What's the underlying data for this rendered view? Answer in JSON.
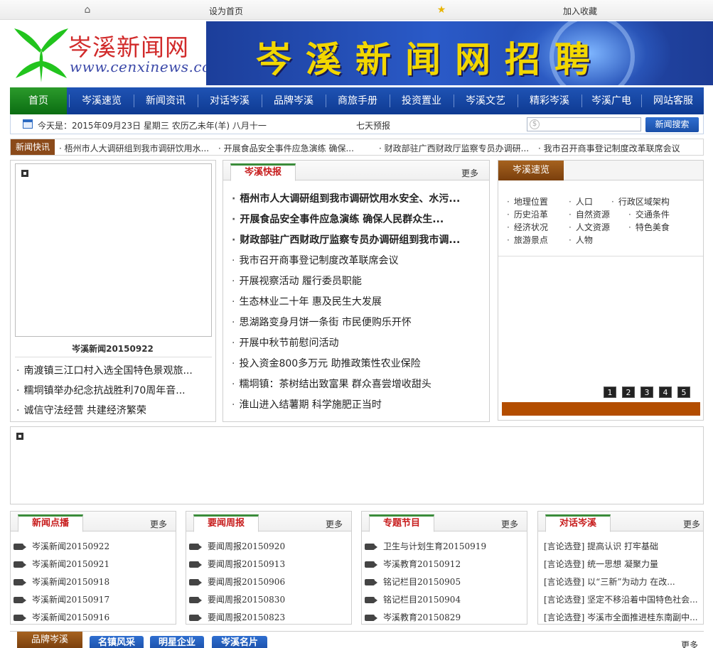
{
  "topbar": {
    "set_home": "设为首页",
    "bookmark": "加入收藏"
  },
  "logo": {
    "name": "岑溪新闻网",
    "url": "www.cenxinews.com"
  },
  "banner": {
    "text": "岑溪新闻网招聘"
  },
  "nav": {
    "items": [
      "首页",
      "岑溪速览",
      "新闻资讯",
      "对话岑溪",
      "品牌岑溪",
      "商旅手册",
      "投资置业",
      "岑溪文艺",
      "精彩岑溪",
      "岑溪广电",
      "网站客服"
    ]
  },
  "datebar": {
    "date": "今天是：2015年09月23日  星期三   农历乙未年(羊) 八月十一",
    "forecast": "七天预报",
    "search_button": "新闻搜索",
    "search_placeholder": ""
  },
  "ticker": {
    "label": "新闻快讯",
    "items": [
      "梧州市人大调研组到我市调研饮用水...",
      "开展食品安全事件应急演练 确保...",
      "财政部驻广西财政厅监察专员办调研...",
      "我市召开商事登记制度改革联席会议"
    ]
  },
  "left": {
    "caption": "岑溪新闻20150922",
    "items": [
      "南渡镇三江口村入选全国特色景观旅...",
      "糯垌镇举办纪念抗战胜利70周年音...",
      "诚信守法经营 共建经济繁荣"
    ]
  },
  "center": {
    "tab": "岑溪快报",
    "more": "更多",
    "headlines": [
      "梧州市人大调研组到我市调研饮用水安全、水污...",
      "开展食品安全事件应急演练  确保人民群众生...",
      "财政部驻广西财政厅监察专员办调研组到我市调..."
    ],
    "items": [
      "我市召开商事登记制度改革联席会议",
      "开展视察活动  履行委员职能",
      "生态林业二十年  惠及民生大发展",
      "思湖路变身月饼一条街  市民便购乐开怀",
      "开展中秋节前慰问活动",
      "投入资金800多万元  助推政策性农业保险",
      "糯垌镇：茶树结出致富果  群众喜尝增收甜头",
      "淮山进入结薯期  科学施肥正当时"
    ]
  },
  "speed": {
    "tab": "岑溪速览",
    "rows": [
      [
        "地理位置",
        "人口",
        "行政区域架构"
      ],
      [
        "历史沿革",
        "自然资源",
        "交通条件"
      ],
      [
        "经济状况",
        "人文资源",
        "特色美食"
      ],
      [
        "旅游景点",
        "人物"
      ]
    ],
    "pages": [
      "1",
      "2",
      "3",
      "4",
      "5"
    ]
  },
  "boxes": [
    {
      "tab": "新闻点播",
      "more": "更多",
      "items": [
        "岑溪新闻20150922",
        "岑溪新闻20150921",
        "岑溪新闻20150918",
        "岑溪新闻20150917",
        "岑溪新闻20150916"
      ]
    },
    {
      "tab": "要闻周报",
      "more": "更多",
      "items": [
        "要闻周报20150920",
        "要闻周报20150913",
        "要闻周报20150906",
        "要闻周报20150830",
        "要闻周报20150823"
      ]
    },
    {
      "tab": "专题节目",
      "more": "更多",
      "items": [
        "卫生与计划生育20150919",
        "岑溪教育20150912",
        "铭记栏目20150905",
        "铭记栏目20150904",
        "岑溪教育20150829"
      ]
    },
    {
      "tab": "对话岑溪",
      "more": "更多",
      "items": [
        "[言论选登] 提高认识  打牢基础",
        "[言论选登] 统一思想  凝聚力量",
        "[言论选登] 以“三新”为动力 在改...",
        "[言论选登] 坚定不移沿着中国特色社会...",
        "[言论选登] 岑溪市全面推进桂东南副中..."
      ]
    }
  ],
  "brand": {
    "tab": "品牌岑溪",
    "tabs": [
      "名镇风采",
      "明星企业",
      "岑溪名片"
    ],
    "more": "更多"
  }
}
